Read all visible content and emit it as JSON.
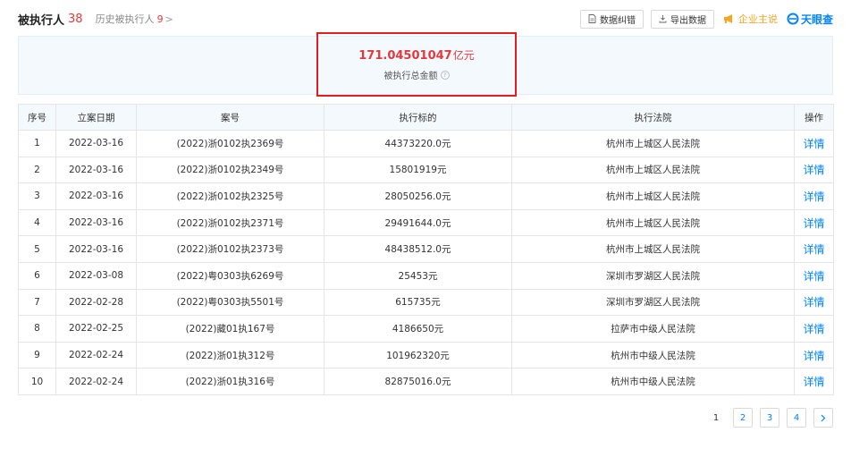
{
  "header": {
    "title": "被执行人",
    "count": "38",
    "history_label": "历史被执行人",
    "history_count": "9",
    "error_button": "数据纠错",
    "export_button": "导出数据",
    "enterprise_say": "企业主说",
    "brand": "天眼查"
  },
  "summary": {
    "amount": "171.04501047",
    "unit": "亿元",
    "label": "被执行总金额"
  },
  "table": {
    "columns": [
      "序号",
      "立案日期",
      "案号",
      "执行标的",
      "执行法院",
      "操作"
    ],
    "rows": [
      {
        "idx": "1",
        "date": "2022-03-16",
        "case": "(2022)浙0102执2369号",
        "amount": "44373220.0元",
        "court": "杭州市上城区人民法院",
        "action": "详情"
      },
      {
        "idx": "2",
        "date": "2022-03-16",
        "case": "(2022)浙0102执2349号",
        "amount": "15801919元",
        "court": "杭州市上城区人民法院",
        "action": "详情"
      },
      {
        "idx": "3",
        "date": "2022-03-16",
        "case": "(2022)浙0102执2325号",
        "amount": "28050256.0元",
        "court": "杭州市上城区人民法院",
        "action": "详情"
      },
      {
        "idx": "4",
        "date": "2022-03-16",
        "case": "(2022)浙0102执2371号",
        "amount": "29491644.0元",
        "court": "杭州市上城区人民法院",
        "action": "详情"
      },
      {
        "idx": "5",
        "date": "2022-03-16",
        "case": "(2022)浙0102执2373号",
        "amount": "48438512.0元",
        "court": "杭州市上城区人民法院",
        "action": "详情"
      },
      {
        "idx": "6",
        "date": "2022-03-08",
        "case": "(2022)粤0303执6269号",
        "amount": "25453元",
        "court": "深圳市罗湖区人民法院",
        "action": "详情"
      },
      {
        "idx": "7",
        "date": "2022-02-28",
        "case": "(2022)粤0303执5501号",
        "amount": "615735元",
        "court": "深圳市罗湖区人民法院",
        "action": "详情"
      },
      {
        "idx": "8",
        "date": "2022-02-25",
        "case": "(2022)藏01执167号",
        "amount": "4186650元",
        "court": "拉萨市中级人民法院",
        "action": "详情"
      },
      {
        "idx": "9",
        "date": "2022-02-24",
        "case": "(2022)浙01执312号",
        "amount": "101962320元",
        "court": "杭州市中级人民法院",
        "action": "详情"
      },
      {
        "idx": "10",
        "date": "2022-02-24",
        "case": "(2022)浙01执316号",
        "amount": "82875016.0元",
        "court": "杭州市中级人民法院",
        "action": "详情"
      }
    ]
  },
  "pagination": {
    "pages": [
      "1",
      "2",
      "3",
      "4"
    ],
    "current": "1",
    "next_icon": "chevron-right-icon"
  },
  "colors": {
    "accent_red": "#e4393c",
    "link_blue": "#0084ff",
    "header_bg": "#f4f9fd",
    "highlight_border": "#e02020"
  }
}
